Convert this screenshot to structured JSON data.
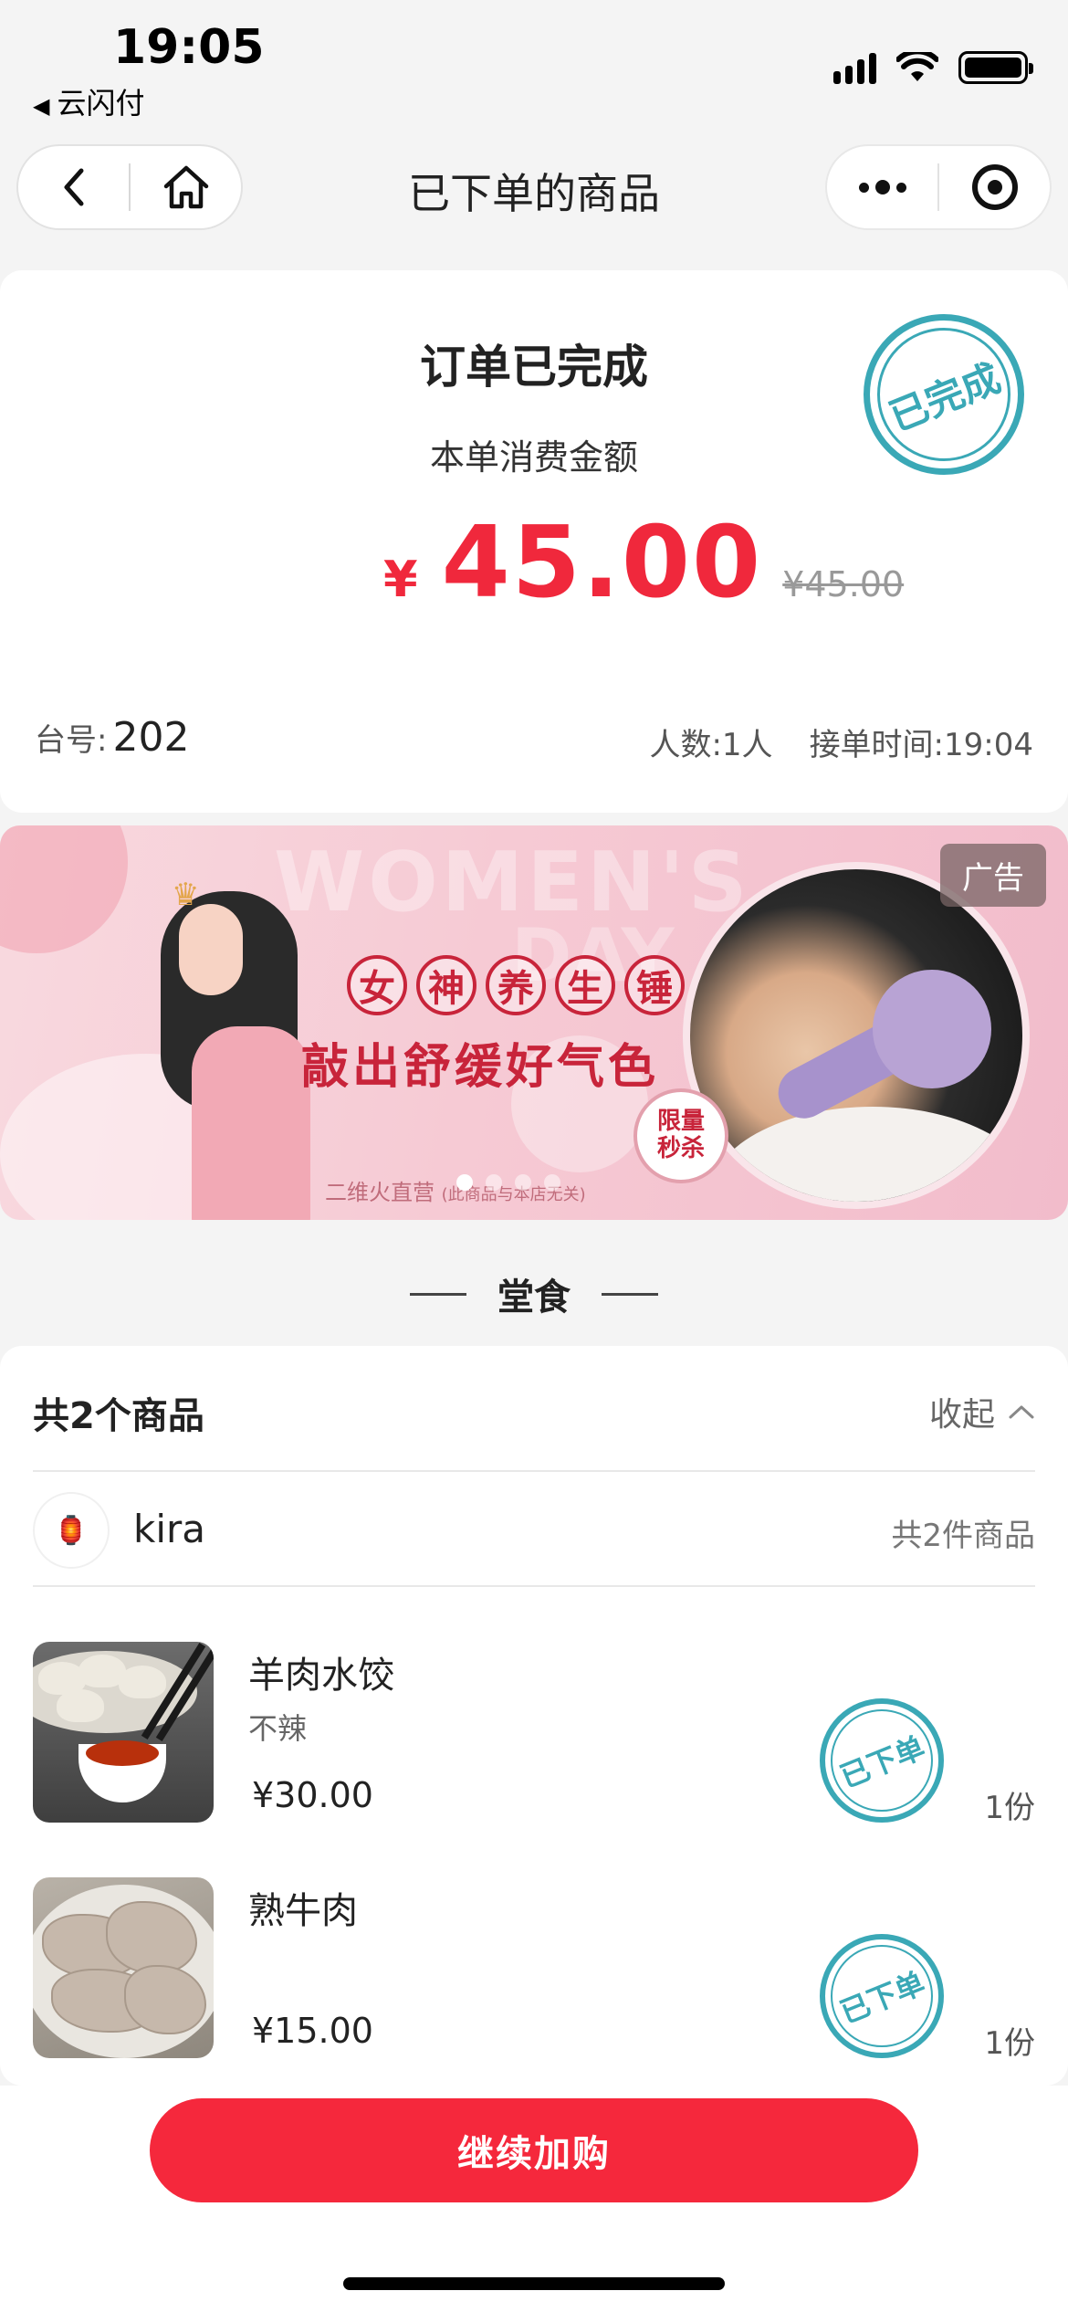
{
  "status_bar": {
    "time": "19:05",
    "back_app": "云闪付",
    "icons": [
      "signal-icon",
      "wifi-icon",
      "battery-icon"
    ]
  },
  "navbar": {
    "title": "已下单的商品",
    "left_icons": [
      "back-icon",
      "home-icon"
    ],
    "right_icons": [
      "more-icon",
      "close-miniprogram-icon"
    ]
  },
  "order": {
    "status": "订单已完成",
    "amount_label": "本单消费金额",
    "currency_symbol": "¥",
    "amount": "45.00",
    "original_amount": "¥45.00",
    "stamp_text": "已完成",
    "table_label": "台号:",
    "table_number": "202",
    "people": "人数:1人",
    "order_time": "接单时间:19:04"
  },
  "ad": {
    "tag": "广告",
    "watermark": "WOMEN'S",
    "watermark2": "DAY",
    "headline_chars": [
      "女",
      "神",
      "养",
      "生",
      "锤"
    ],
    "subline": "敲出舒缓好气色",
    "seal_line1": "限量",
    "seal_line2": "秒杀",
    "footer": "二维火直营",
    "footer_note": "(此商品与本店无关)",
    "slide_count": 4,
    "active_slide": 0
  },
  "section": {
    "title": "堂食"
  },
  "items_card": {
    "count_label": "共2个商品",
    "collapse_label": "收起",
    "shop_name": "kira",
    "shop_count": "共2件商品",
    "items": [
      {
        "name": "羊肉水饺",
        "spec": "不辣",
        "price": "¥30.00",
        "qty": "1份",
        "stamp": "已下单"
      },
      {
        "name": "熟牛肉",
        "spec": "",
        "price": "¥15.00",
        "qty": "1份",
        "stamp": "已下单"
      }
    ]
  },
  "bottom": {
    "button_label": "继续加购"
  },
  "colors": {
    "accent_red": "#f5283c",
    "stamp_teal": "#3aa8b6",
    "background": "#f4f4f4"
  }
}
